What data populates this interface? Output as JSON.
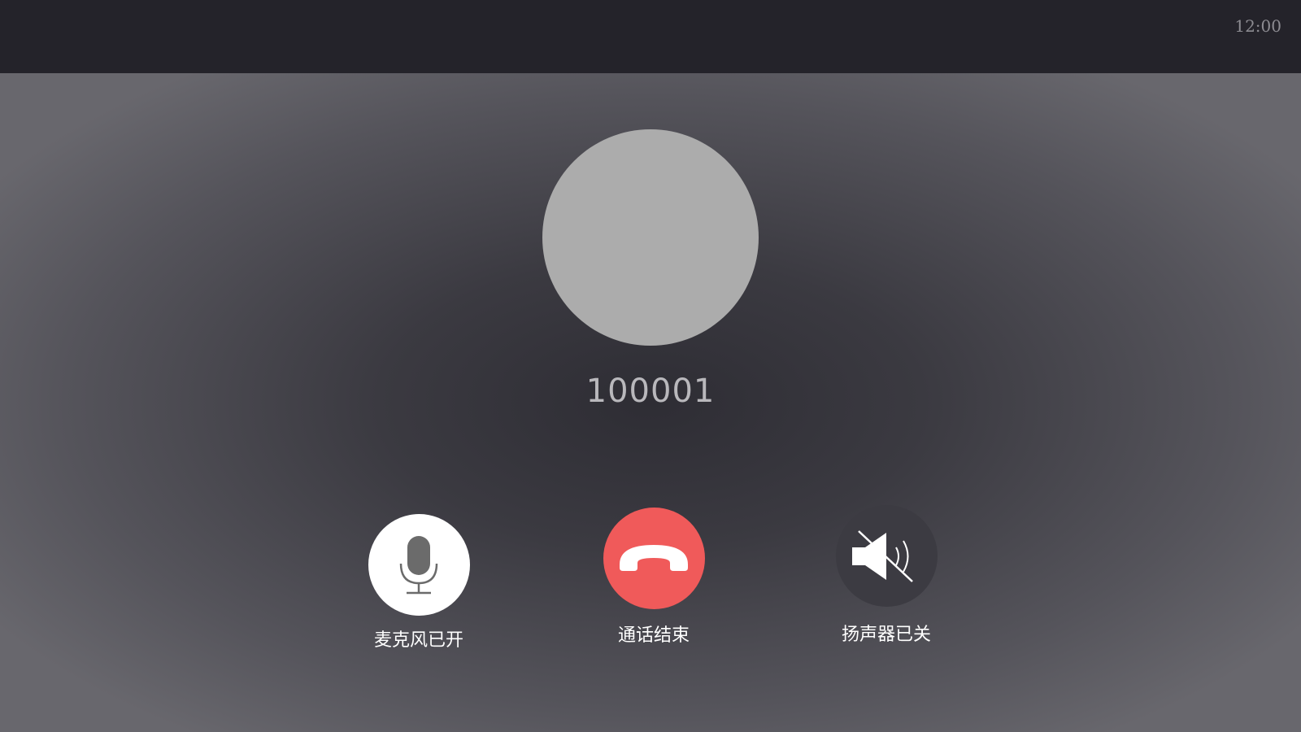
{
  "status_bar": {
    "time": "12:00"
  },
  "caller": {
    "number": "100001"
  },
  "controls": {
    "mic": {
      "label": "麦克风已开",
      "icon": "microphone-icon"
    },
    "end_call": {
      "label": "通话结束",
      "icon": "phone-hangup-icon",
      "color": "#f05a5a"
    },
    "speaker": {
      "label": "扬声器已关",
      "icon": "speaker-muted-icon"
    }
  },
  "colors": {
    "status_bar_bg": "#24232a",
    "avatar": "#acacac",
    "end_call": "#f05a5a"
  }
}
